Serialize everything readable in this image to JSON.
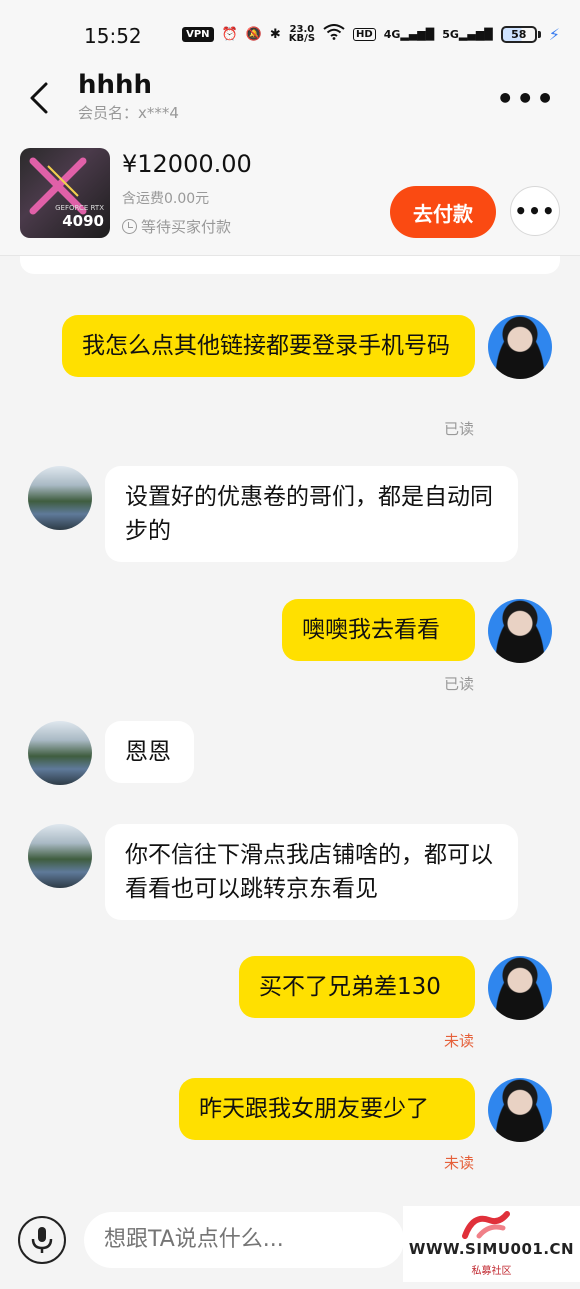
{
  "status_bar": {
    "time": "15:52",
    "vpn": "VPN",
    "net_speed_value": "23.0",
    "net_speed_unit": "KB/S",
    "hd": "HD",
    "signal_1": "4G",
    "signal_2": "5G",
    "battery": "58"
  },
  "header": {
    "title": "hhhh",
    "member_label": "会员名：x***4"
  },
  "product": {
    "price": "¥12000.00",
    "shipping": "含运费0.00元",
    "status": "等待买家付款",
    "pay_button": "去付款",
    "image_text": "4090",
    "image_sub": "GEFORCE RTX"
  },
  "messages": [
    {
      "side": "me",
      "text": "我怎么点其他链接都要登录手机号码",
      "receipt": "已读"
    },
    {
      "side": "them",
      "text": "设置好的优惠卷的哥们，都是自动同步的"
    },
    {
      "side": "me",
      "text": "噢噢我去看看",
      "receipt": "已读"
    },
    {
      "side": "them",
      "text": "恩恩"
    },
    {
      "side": "them",
      "text": "你不信往下滑点我店铺啥的，都可以看看也可以跳转京东看见"
    },
    {
      "side": "me",
      "text": "买不了兄弟差130",
      "receipt": "未读"
    },
    {
      "side": "me",
      "text": "昨天跟我女朋友要少了",
      "receipt": "未读"
    }
  ],
  "input": {
    "placeholder": "想跟TA说点什么..."
  },
  "watermark": {
    "site": "WWW.SIMU001.CN",
    "sub": "私募社区"
  },
  "colors": {
    "my_bubble": "#ffe000",
    "their_bubble": "#ffffff",
    "pay_button": "#fa4a12",
    "unread": "#e5603a"
  }
}
